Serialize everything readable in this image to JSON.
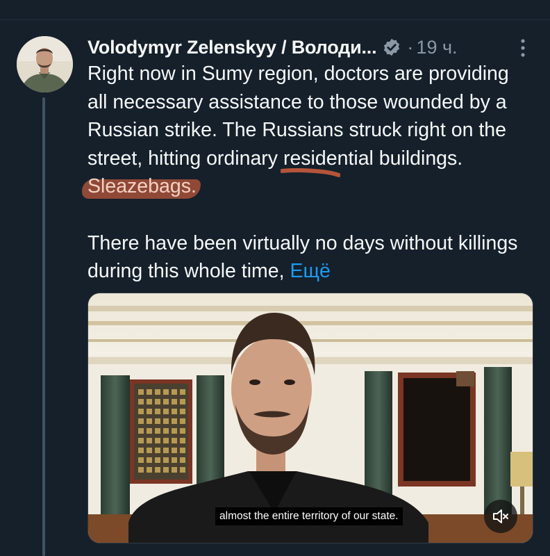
{
  "tweet": {
    "author_name": "Volodymyr Zelenskyy / Володи...",
    "verified_icon": "verified-badge-icon",
    "separator": "·",
    "timestamp": "19 ч.",
    "more_icon": "more-vertical-icon",
    "text_line1": "Right now in Sumy region, doctors are providing all necessary assistance to those wounded by a Russian strike. The Russians struck right on the street, hitting ordinary residential buildings. ",
    "highlighted_word": "Sleazebags.",
    "text_line2": "There have been virtually no days without killings during this whole time, ",
    "show_more_label": "Ещё"
  },
  "media": {
    "subtitle": "almost the entire territory of our state.",
    "mute_icon": "volume-muted-icon"
  },
  "colors": {
    "background": "#15202b",
    "text": "#f7f9f9",
    "secondary": "#8b98a5",
    "link": "#1d9bf0",
    "highlight": "#b4543a",
    "verified": "#8b98a5"
  }
}
